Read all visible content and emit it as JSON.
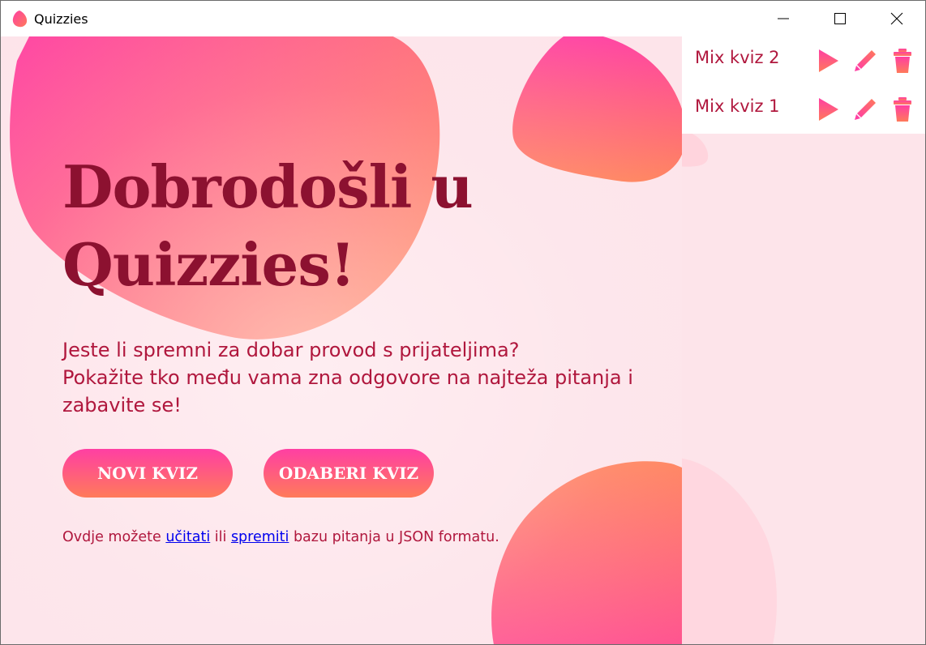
{
  "window": {
    "title": "Quizzies",
    "controls": [
      "minimize-icon",
      "maximize-icon",
      "close-icon"
    ]
  },
  "colors": {
    "heading": "#8c1130",
    "text": "#b0173d",
    "accent_start": "#ff3fa3",
    "accent_end": "#ff7a5a",
    "background": "#fde4ea",
    "link": "#0000ee"
  },
  "main": {
    "heading_line1": "Dobrodošli u",
    "heading_line2": "Quizzies!",
    "subtitle_line1": "Jeste li spremni za dobar provod s prijateljima?",
    "subtitle_line2": "Pokažite tko među vama zna odgovore na najteža pitanja i",
    "subtitle_line3": "zabavite se!",
    "new_quiz_label": "NOVI KVIZ",
    "choose_quiz_label": "ODABERI KVIZ",
    "footer_prefix": "Ovdje možete ",
    "footer_load_link": "učitati",
    "footer_middle": " ili ",
    "footer_save_link": "spremiti",
    "footer_suffix": " bazu pitanja u JSON formatu."
  },
  "sidebar": {
    "quizzes": [
      {
        "name": "Mix kviz 2",
        "actions": [
          "play-icon",
          "edit-pencil-icon",
          "delete-trash-icon"
        ]
      },
      {
        "name": "Mix kviz 1",
        "actions": [
          "play-icon",
          "edit-pencil-icon",
          "delete-trash-icon"
        ]
      }
    ]
  }
}
